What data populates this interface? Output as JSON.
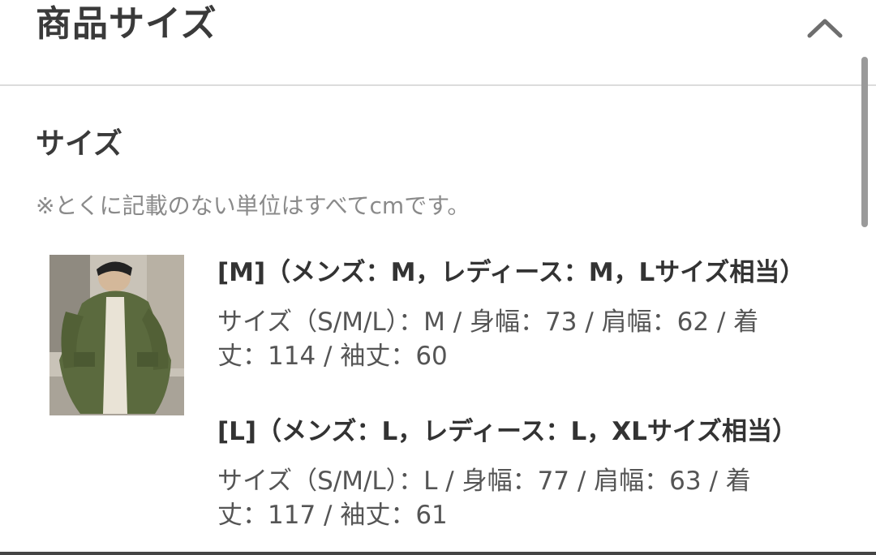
{
  "header": {
    "title": "商品サイズ",
    "collapse_icon": "chevron-up-icon"
  },
  "section": {
    "title": "サイズ",
    "note": "※とくに記載のない単位はすべてcmです。"
  },
  "product_image": {
    "icon": "product-photo-olive-coat"
  },
  "sizes": [
    {
      "heading": "[M]（メンズ：M，レディース：M，Lサイズ相当）",
      "detail_line1": "サイズ（S/M/L）：M / 身幅：73 / 肩幅：62 / 着",
      "detail_line2": "丈：114 / 袖丈：60"
    },
    {
      "heading": "[L]（メンズ：L，レディース：L，XLサイズ相当）",
      "detail_line1": "サイズ（S/M/L）：L / 身幅：77 / 肩幅：63 / 着",
      "detail_line2": "丈：117 / 袖丈：61"
    }
  ],
  "colors": {
    "text": "#333333",
    "muted": "#8a8a8a",
    "divider": "#dcdcdc"
  }
}
